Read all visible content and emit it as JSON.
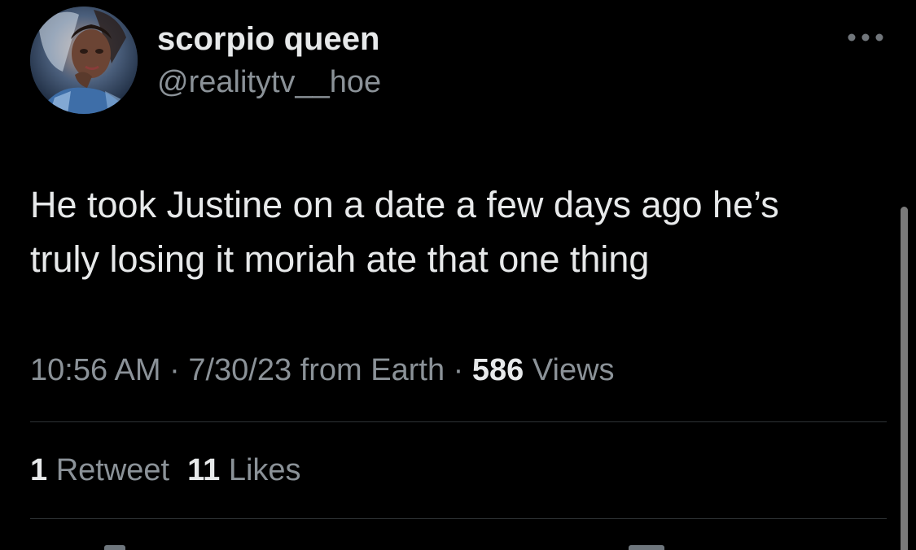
{
  "tweet": {
    "author": {
      "display_name": "scorpio queen",
      "handle": "@realitytv__hoe",
      "avatar_icon": "profile-photo"
    },
    "more_icon": "ellipsis-icon",
    "text_lines": [
      "He took Justine on a date a few days ago he’s",
      "truly losing it moriah ate that one thing"
    ],
    "meta": {
      "time": "10:56 AM",
      "sep1": " · ",
      "date": "7/30/23",
      "source": " from Earth",
      "sep2": " · ",
      "views_count": "586",
      "views_label": " Views"
    },
    "stats": {
      "retweets_count": "1",
      "retweets_label": " Retweet",
      "likes_count": "11",
      "likes_label": " Likes"
    }
  },
  "colors": {
    "background": "#000000",
    "primary_text": "#e7e9ea",
    "secondary_text": "#8b9298",
    "divider": "#2f3336"
  }
}
